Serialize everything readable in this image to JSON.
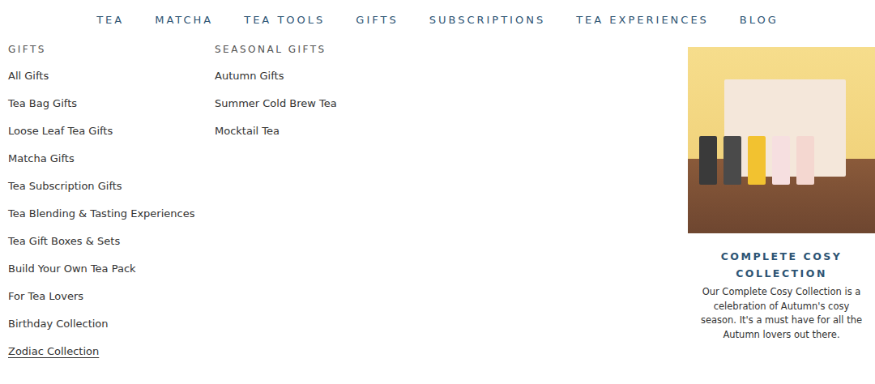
{
  "nav": {
    "items": [
      "TEA",
      "MATCHA",
      "TEA TOOLS",
      "GIFTS",
      "SUBSCRIPTIONS",
      "TEA EXPERIENCES",
      "BLOG"
    ]
  },
  "menu": {
    "columns": [
      {
        "heading": "GIFTS",
        "items": [
          {
            "label": "All Gifts",
            "hovered": false
          },
          {
            "label": "Tea Bag Gifts",
            "hovered": false
          },
          {
            "label": "Loose Leaf Tea Gifts",
            "hovered": false
          },
          {
            "label": "Matcha Gifts",
            "hovered": false
          },
          {
            "label": "Tea Subscription Gifts",
            "hovered": false
          },
          {
            "label": "Tea Blending & Tasting Experiences",
            "hovered": false
          },
          {
            "label": "Tea Gift Boxes & Sets",
            "hovered": false
          },
          {
            "label": "Build Your Own Tea Pack",
            "hovered": false
          },
          {
            "label": "For Tea Lovers",
            "hovered": false
          },
          {
            "label": "Birthday Collection",
            "hovered": false
          },
          {
            "label": "Zodiac Collection",
            "hovered": true
          }
        ]
      },
      {
        "heading": "SEASONAL GIFTS",
        "items": [
          {
            "label": "Autumn Gifts",
            "hovered": false
          },
          {
            "label": "Summer Cold Brew Tea",
            "hovered": false
          },
          {
            "label": "Mocktail Tea",
            "hovered": false
          }
        ]
      }
    ]
  },
  "featured": {
    "title": "COMPLETE COSY COLLECTION",
    "description": "Our Complete Cosy Collection is a celebration of Autumn's cosy season. It's a must have for all the Autumn lovers out there."
  }
}
